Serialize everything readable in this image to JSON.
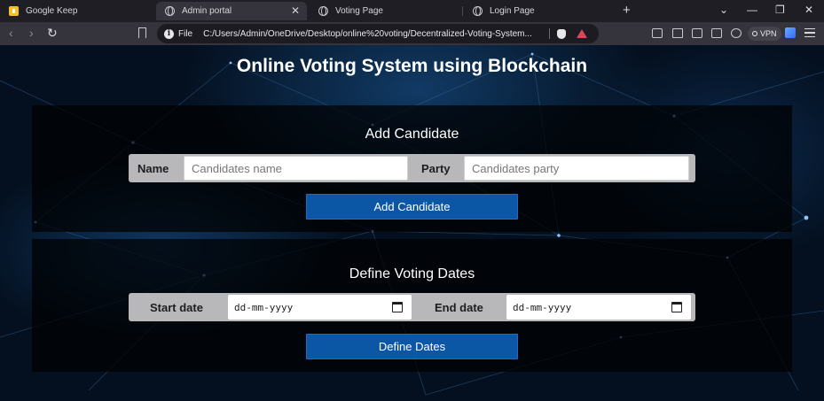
{
  "browser": {
    "tabs": [
      {
        "title": "Google Keep",
        "icon": "google-keep-icon",
        "active": false
      },
      {
        "title": "Admin portal",
        "icon": "globe-icon",
        "active": true
      },
      {
        "title": "Voting Page",
        "icon": "globe-icon",
        "active": false
      },
      {
        "title": "Login Page",
        "icon": "globe-icon",
        "active": false
      }
    ],
    "scheme_label": "File",
    "url": "C:/Users/Admin/OneDrive/Desktop/online%20voting/Decentralized-Voting-System...",
    "vpn_label": "VPN"
  },
  "page": {
    "title": "Online Voting System using Blockchain",
    "add_candidate": {
      "heading": "Add Candidate",
      "name_label": "Name",
      "name_placeholder": "Candidates name",
      "party_label": "Party",
      "party_placeholder": "Candidates party",
      "button_label": "Add Candidate"
    },
    "define_dates": {
      "heading": "Define Voting Dates",
      "start_label": "Start date",
      "start_value": "dd-mm-yyyy",
      "end_label": "End date",
      "end_value": "dd-mm-yyyy",
      "button_label": "Define Dates"
    }
  },
  "colors": {
    "button": "#0b57a6",
    "panel": "rgba(0,0,0,0.72)",
    "form_row": "#b8b8bb"
  }
}
